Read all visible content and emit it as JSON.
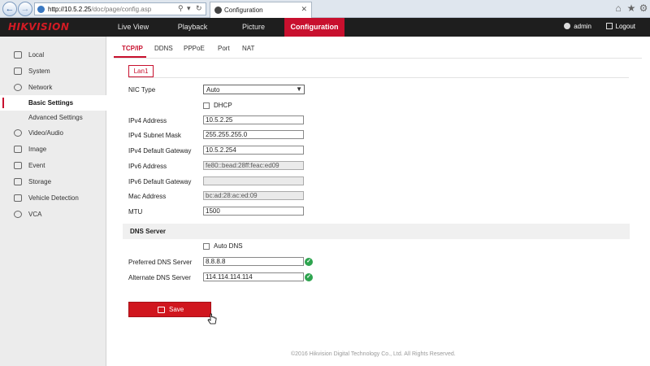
{
  "browser": {
    "url_host": "http://10.5.2.25",
    "url_path": "/doc/page/config.asp",
    "tab_title": "Configuration"
  },
  "header": {
    "logo": "HIKVISION",
    "nav": [
      "Live View",
      "Playback",
      "Picture",
      "Configuration"
    ],
    "active_nav": "Configuration",
    "user": "admin",
    "logout": "Logout",
    "accent_color": "#c8102e"
  },
  "sidebar": {
    "items": [
      {
        "label": "Local",
        "icon": "monitor-icon"
      },
      {
        "label": "System",
        "icon": "system-icon"
      },
      {
        "label": "Network",
        "icon": "globe-icon"
      },
      {
        "label": "Basic Settings",
        "icon": ""
      },
      {
        "label": "Advanced Settings",
        "icon": ""
      },
      {
        "label": "Video/Audio",
        "icon": "video-audio-icon"
      },
      {
        "label": "Image",
        "icon": "image-icon"
      },
      {
        "label": "Event",
        "icon": "calendar-icon"
      },
      {
        "label": "Storage",
        "icon": "storage-icon"
      },
      {
        "label": "Vehicle Detection",
        "icon": "vehicle-icon"
      },
      {
        "label": "VCA",
        "icon": "vca-icon"
      }
    ],
    "active_item": "Basic Settings"
  },
  "subtabs": [
    "TCP/IP",
    "DDNS",
    "PPPoE",
    "Port",
    "NAT"
  ],
  "active_subtab": "TCP/IP",
  "lan_tab": "Lan1",
  "form": {
    "nic_type": {
      "label": "NIC Type",
      "value": "Auto"
    },
    "dhcp": {
      "label": "DHCP",
      "checked": false
    },
    "ipv4_address": {
      "label": "IPv4 Address",
      "value": "10.5.2.25"
    },
    "ipv4_subnet": {
      "label": "IPv4 Subnet Mask",
      "value": "255.255.255.0"
    },
    "ipv4_gateway": {
      "label": "IPv4 Default Gateway",
      "value": "10.5.2.254"
    },
    "ipv6_address": {
      "label": "IPv6 Address",
      "value": "fe80::bead:28ff:feac:ed09"
    },
    "ipv6_gateway": {
      "label": "IPv6 Default Gateway",
      "value": ""
    },
    "mac_address": {
      "label": "Mac Address",
      "value": "bc:ad:28:ac:ed:09"
    },
    "mtu": {
      "label": "MTU",
      "value": "1500"
    }
  },
  "dns": {
    "header": "DNS Server",
    "auto_dns": {
      "label": "Auto DNS",
      "checked": false
    },
    "preferred": {
      "label": "Preferred DNS Server",
      "value": "8.8.8.8"
    },
    "alternate": {
      "label": "Alternate DNS Server",
      "value": "114.114.114.114"
    }
  },
  "save_label": "Save",
  "footer": "©2016 Hikvision Digital Technology Co., Ltd. All Rights Reserved."
}
